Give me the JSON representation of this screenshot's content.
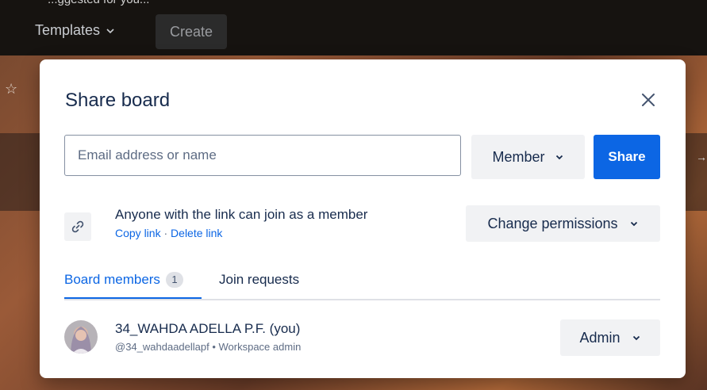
{
  "background": {
    "partial_header_text": "...ggested for you...",
    "templates_label": "Templates",
    "create_label": "Create"
  },
  "dialog": {
    "title": "Share board",
    "email_placeholder": "Email address or name",
    "role_label": "Member",
    "share_label": "Share",
    "link_text": "Anyone with the link can join as a member",
    "copy_link": "Copy link",
    "separator": "·",
    "delete_link": "Delete link",
    "change_permissions_label": "Change permissions",
    "tabs": {
      "members_label": "Board members",
      "members_count": "1",
      "requests_label": "Join requests"
    },
    "member": {
      "name": "34_WAHDA ADELLA P.F. (you)",
      "subtitle": "@34_wahdaadellapf • Workspace admin",
      "role": "Admin"
    }
  },
  "colors": {
    "primary": "#0c66e4",
    "text": "#172b4d",
    "subtle_text": "#5e6c84",
    "button_bg": "#f1f2f4"
  }
}
